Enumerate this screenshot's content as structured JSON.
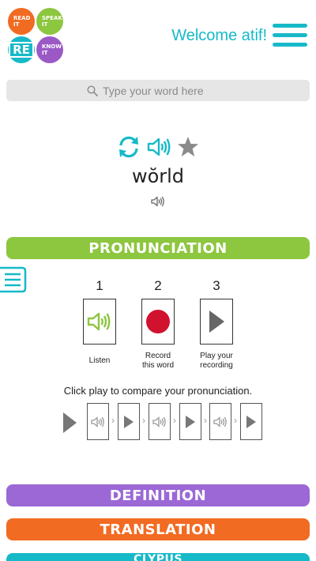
{
  "logo": {
    "q1": [
      "READ",
      "IT"
    ],
    "q2": [
      "SPEAK",
      "IT"
    ],
    "q3": "RE",
    "q4": [
      "KNOW",
      "IT"
    ]
  },
  "header": {
    "welcome": "Welcome atif!"
  },
  "search": {
    "placeholder": "Type your word here"
  },
  "word": {
    "text": "wŏrld"
  },
  "sections": {
    "pronunciation": "PRONUNCIATION",
    "definition": "DEFINITION",
    "translation": "TRANSLATION",
    "clypus": "CLYPUS"
  },
  "steps": [
    {
      "num": "1",
      "label_line1": "Listen",
      "label_line2": ""
    },
    {
      "num": "2",
      "label_line1": "Record",
      "label_line2": "this word"
    },
    {
      "num": "3",
      "label_line1": "Play your",
      "label_line2": "recording"
    }
  ],
  "compare_text": "Click play to compare your pronunciation.",
  "colors": {
    "teal": "#16b9c8",
    "green": "#8dc63f",
    "purple": "#9b68d6",
    "orange": "#f26b22",
    "record_red": "#d0122f"
  }
}
